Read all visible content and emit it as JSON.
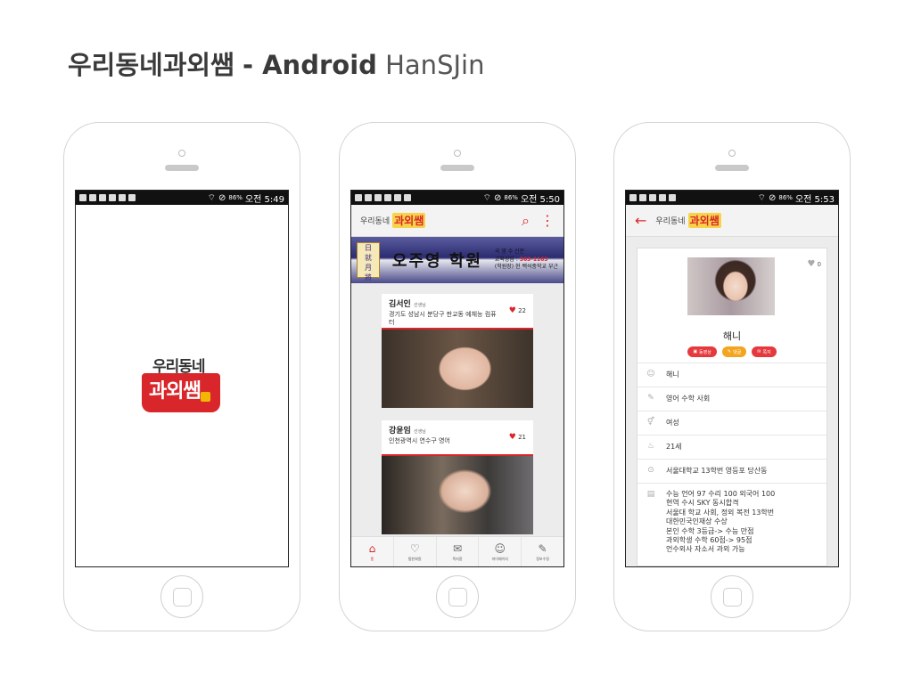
{
  "header": {
    "title_korean": "우리동네과외쌤",
    "title_platform": "- Android",
    "author": "HanSJin"
  },
  "phones": [
    {
      "status_bar": {
        "battery": "86%",
        "time": "오전 5:49"
      },
      "splash": {
        "logo_top": "우리동네",
        "logo_main": "과외쌤"
      }
    },
    {
      "status_bar": {
        "battery": "86%",
        "time": "오전 5:50"
      },
      "appbar": {
        "logo_small": "우리동네",
        "logo_main": "과외쌤"
      },
      "banner": {
        "seal_chars": [
          "日",
          "就",
          "月",
          "將"
        ],
        "academy_name": "오주영 학원",
        "info_line1": "국 영 수 신문",
        "info_label": "교육상담 :",
        "info_phone": "363-1163",
        "info_line3": "(학원장) 현 백석중학교 부근"
      },
      "cards": [
        {
          "name": "김서인",
          "suffix": "선생님",
          "address": "경기도 성남시 분당구 판교동 예체능 컴퓨터",
          "likes": "22"
        },
        {
          "name": "강윤임",
          "suffix": "선생님",
          "address": "인천광역시 연수구 영어",
          "likes": "21"
        }
      ],
      "bottom_nav": [
        {
          "label": "홈",
          "icon": "home-icon"
        },
        {
          "label": "찜한회원",
          "icon": "heart-outline-icon"
        },
        {
          "label": "쪽지함",
          "icon": "chat-icon"
        },
        {
          "label": "마이페이지",
          "icon": "person-icon"
        },
        {
          "label": "정보수정",
          "icon": "edit-icon"
        }
      ]
    },
    {
      "status_bar": {
        "battery": "86%",
        "time": "오전 5:53"
      },
      "appbar": {
        "logo_small": "우리동네",
        "logo_main": "과외쌤"
      },
      "profile": {
        "name": "해니",
        "likes": "0",
        "actions": [
          {
            "label": "동영상",
            "color": "#e5393d"
          },
          {
            "label": "댓글",
            "color": "#f3a51f"
          },
          {
            "label": "쪽지",
            "color": "#e5393d"
          }
        ],
        "rows": [
          {
            "icon": "person-icon",
            "text": "해니"
          },
          {
            "icon": "pen-icon",
            "text": "영어 수학 사회"
          },
          {
            "icon": "gender-icon",
            "text": "여성"
          },
          {
            "icon": "cake-icon",
            "text": "21세"
          },
          {
            "icon": "location-icon",
            "text": "서울대학교 13학번 영등포 당산동"
          }
        ],
        "intro_lines": [
          "수능 언어 97 수리 100 외국어 100",
          "현역 수시 SKY 동시합격",
          "서울대 학교 사회, 정외 복전 13학번",
          "대한민국인재상 수상",
          "본인 수학 3등급-> 수능 만점",
          "과외학생 수학 60점-> 95점",
          "언수외사 자소서 과외 가능"
        ]
      }
    }
  ],
  "colors": {
    "accent": "#d9262b",
    "orange": "#f3a51f",
    "statusbar": "#111111"
  }
}
